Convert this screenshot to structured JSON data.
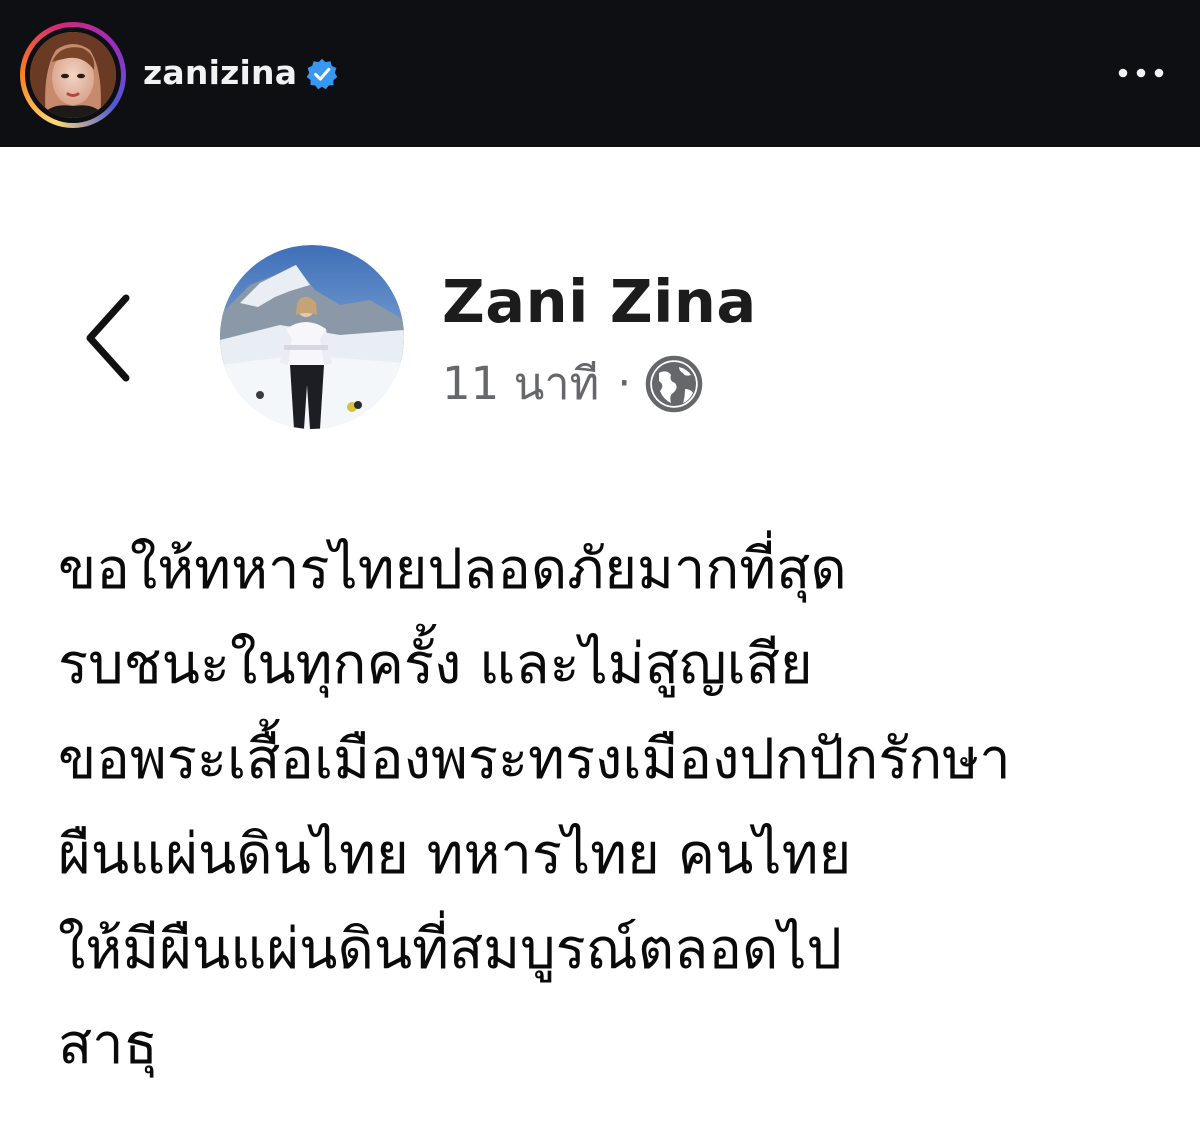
{
  "instagram_header": {
    "username": "zanizina",
    "verified_icon": "verified-badge-icon",
    "more_icon": "more-horizontal-icon",
    "colors": {
      "background": "#0d0f12",
      "text": "#f2f2f2",
      "verified": "#3897f0"
    }
  },
  "post": {
    "author_name": "Zani Zina",
    "time_ago": "11 นาที",
    "separator": "·",
    "privacy_icon": "globe-icon",
    "back_icon": "chevron-left-icon",
    "lines": [
      "ขอให้ทหารไทยปลอดภัยมากที่สุด",
      "รบชนะในทุกครั้ง และไม่สูญเสีย",
      "ขอพระเสื้อเมืองพระทรงเมืองปกปักรักษา",
      "ผืนแผ่นดินไทย ทหารไทย คนไทย",
      "ให้มีผืนแผ่นดินที่สมบูรณ์ตลอดไป",
      "สาธุ"
    ],
    "colors": {
      "name": "#1c1c1c",
      "meta": "#65676b",
      "body": "#0a0a0a"
    }
  }
}
